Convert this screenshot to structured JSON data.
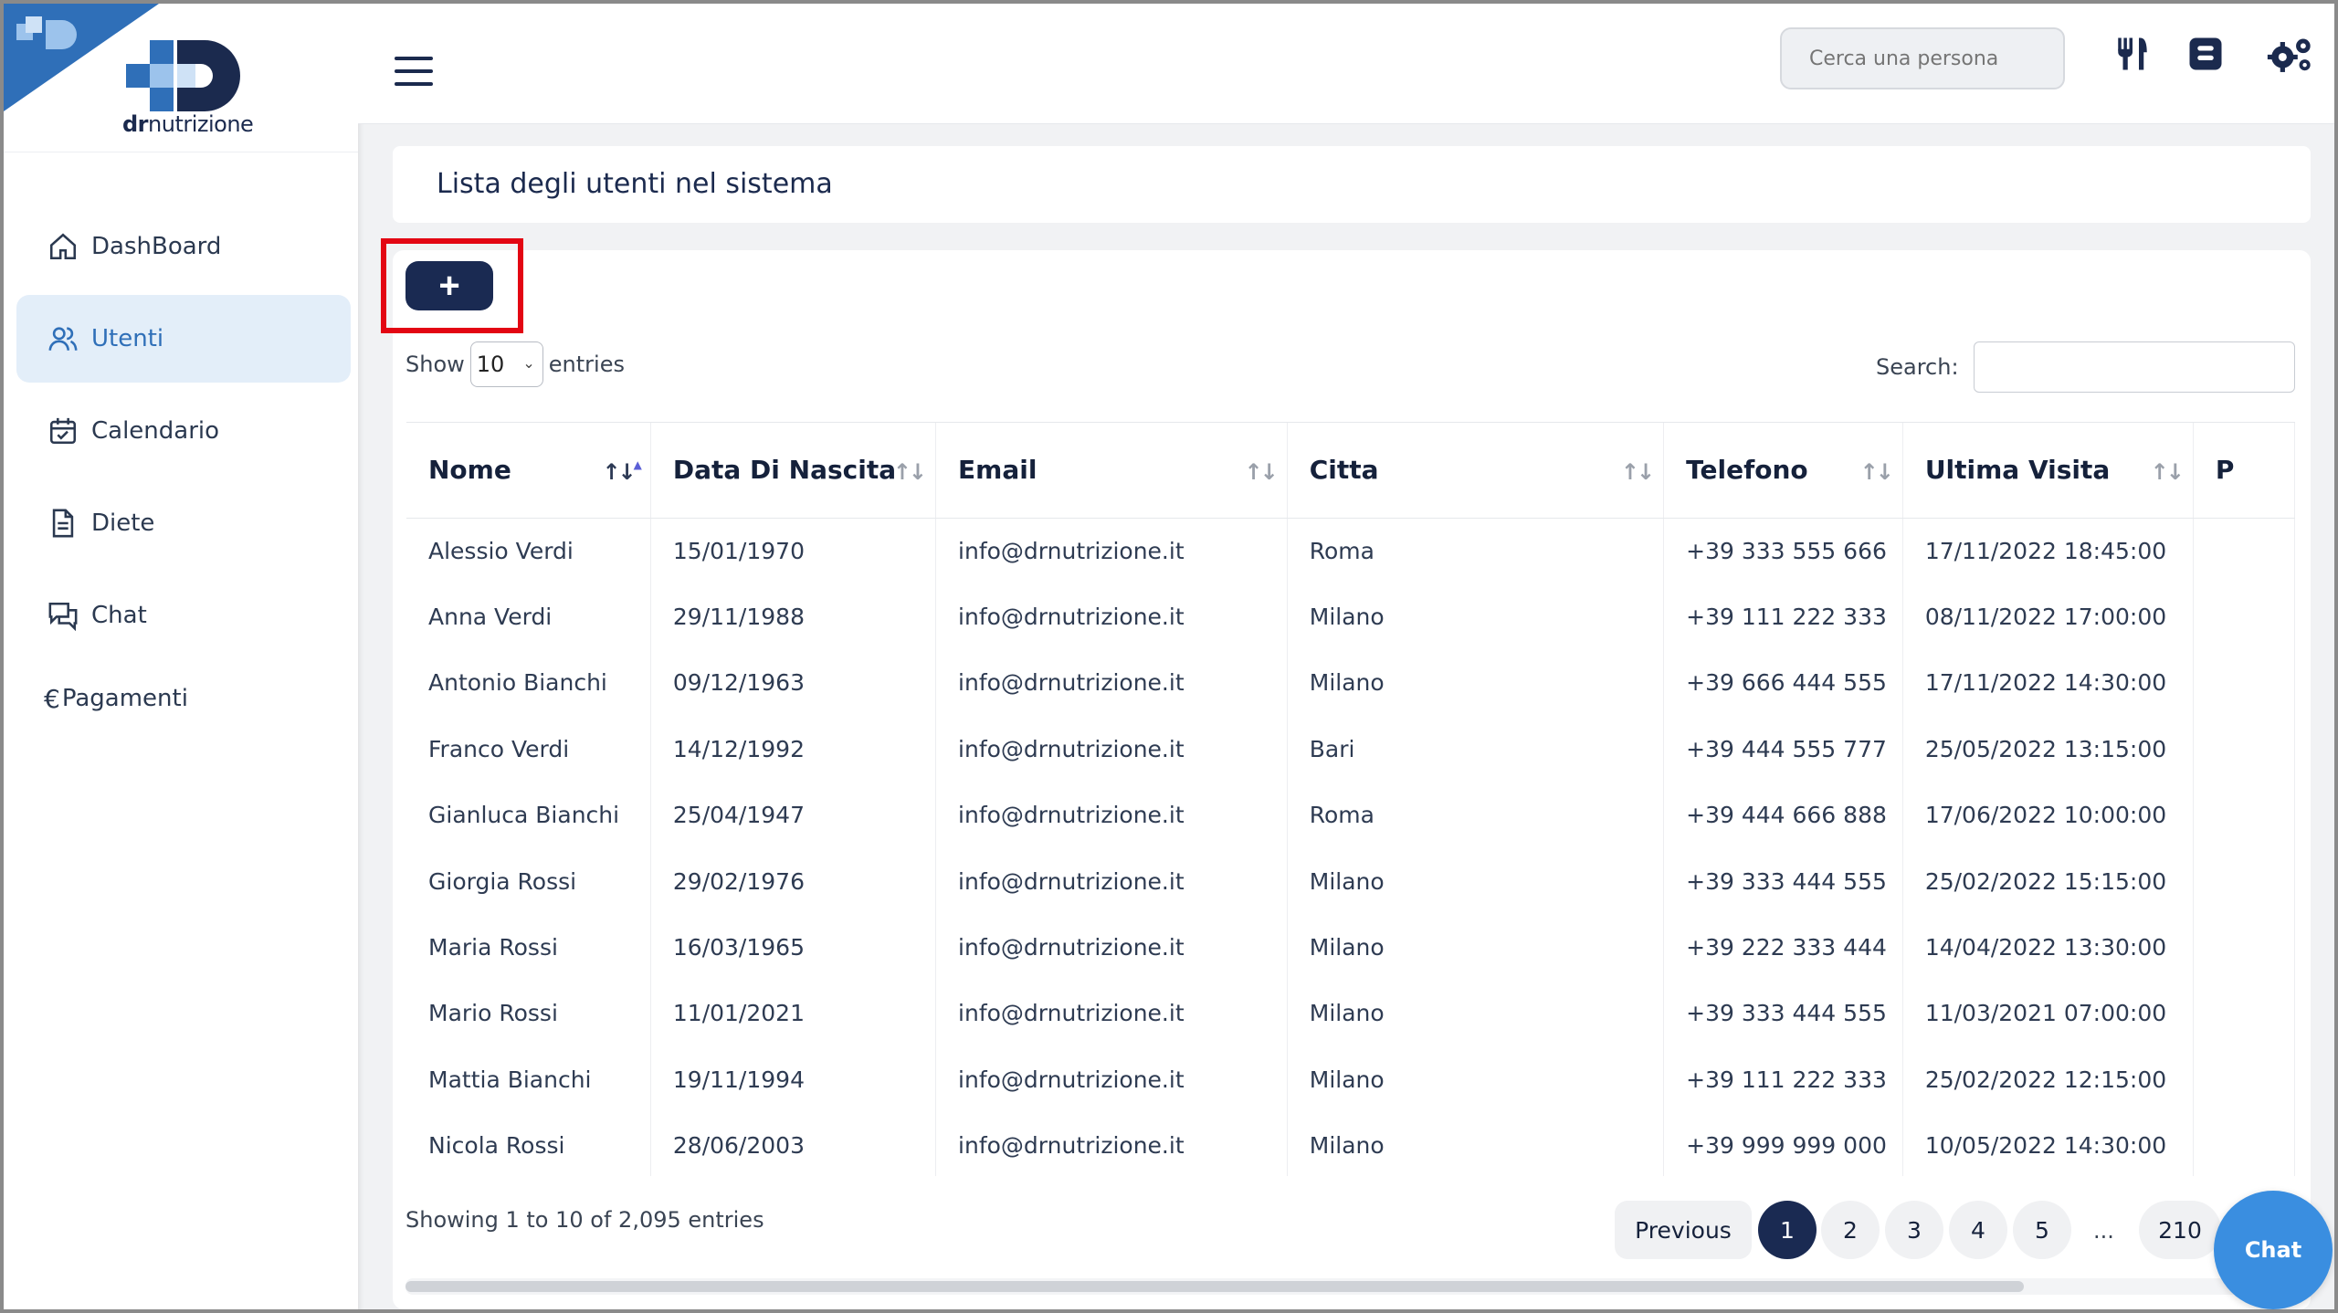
{
  "brand": {
    "logo_prefix": "dr",
    "logo_suffix": "nutrizione"
  },
  "sidebar": {
    "items": [
      {
        "label": "DashBoard",
        "icon": "home-icon"
      },
      {
        "label": "Utenti",
        "icon": "users-icon",
        "active": true
      },
      {
        "label": "Calendario",
        "icon": "calendar-icon"
      },
      {
        "label": "Diete",
        "icon": "document-icon"
      },
      {
        "label": "Chat",
        "icon": "chat-icon"
      },
      {
        "label": "Pagamenti",
        "icon": "euro-icon"
      }
    ]
  },
  "header": {
    "search_placeholder": "Cerca una persona",
    "icons": [
      "utensils-icon",
      "blog-icon",
      "settings-icon"
    ]
  },
  "page": {
    "title": "Lista degli utenti nel sistema"
  },
  "table_controls": {
    "add_label": "+",
    "show_label": "Show",
    "entries_value": "10",
    "entries_label": "entries",
    "search_label": "Search:"
  },
  "table": {
    "columns": [
      "Nome",
      "Data Di Nascita",
      "Email",
      "Citta",
      "Telefono",
      "Ultima Visita",
      "P"
    ],
    "rows": [
      [
        "Alessio Verdi",
        "15/01/1970",
        "info@drnutrizione.it",
        "Roma",
        "+39 333 555 666",
        "17/11/2022 18:45:00"
      ],
      [
        "Anna Verdi",
        "29/11/1988",
        "info@drnutrizione.it",
        "Milano",
        "+39 111 222 333",
        "08/11/2022 17:00:00"
      ],
      [
        "Antonio Bianchi",
        "09/12/1963",
        "info@drnutrizione.it",
        "Milano",
        "+39 666 444 555",
        "17/11/2022 14:30:00"
      ],
      [
        "Franco Verdi",
        "14/12/1992",
        "info@drnutrizione.it",
        "Bari",
        "+39 444 555 777",
        "25/05/2022 13:15:00"
      ],
      [
        "Gianluca Bianchi",
        "25/04/1947",
        "info@drnutrizione.it",
        "Roma",
        "+39 444 666 888",
        "17/06/2022 10:00:00"
      ],
      [
        "Giorgia Rossi",
        "29/02/1976",
        "info@drnutrizione.it",
        "Milano",
        "+39 333 444 555",
        "25/02/2022 15:15:00"
      ],
      [
        "Maria Rossi",
        "16/03/1965",
        "info@drnutrizione.it",
        "Milano",
        "+39 222 333 444",
        "14/04/2022 13:30:00"
      ],
      [
        "Mario Rossi",
        "11/01/2021",
        "info@drnutrizione.it",
        "Milano",
        "+39 333 444 555",
        "11/03/2021 07:00:00"
      ],
      [
        "Mattia Bianchi",
        "19/11/1994",
        "info@drnutrizione.it",
        "Milano",
        "+39 111 222 333",
        "25/02/2022 12:15:00"
      ],
      [
        "Nicola Rossi",
        "28/06/2003",
        "info@drnutrizione.it",
        "Milano",
        "+39 999 999 000",
        "10/05/2022 14:30:00"
      ]
    ]
  },
  "footer": {
    "info": "Showing 1 to 10 of 2,095 entries",
    "previous": "Previous",
    "pages": [
      "1",
      "2",
      "3",
      "4",
      "5"
    ],
    "ellipsis": "...",
    "last_page": "210",
    "current_page": "1"
  },
  "chat_fab": {
    "label": "Chat"
  },
  "colors": {
    "primary": "#1a2a52",
    "accent": "#2f6fb8",
    "highlight": "#e30613",
    "chat": "#3a8ee0"
  }
}
